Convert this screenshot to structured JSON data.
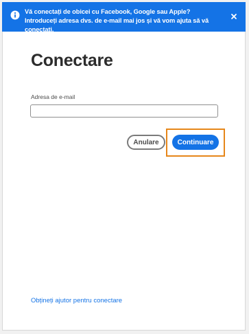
{
  "banner": {
    "message": "Vă conectați de obicei cu Facebook, Google sau Apple? Introduceți adresa dvs. de e-mail mai jos și vă vom ajuta să vă conectați.",
    "info_icon": "info-icon",
    "close_icon": "close-icon"
  },
  "page": {
    "title": "Conectare"
  },
  "form": {
    "email_label": "Adresa de e-mail",
    "email_value": "",
    "email_placeholder": ""
  },
  "actions": {
    "cancel_label": "Anulare",
    "continue_label": "Continuare"
  },
  "footer": {
    "help_link": "Obțineți ajutor pentru conectare"
  },
  "colors": {
    "accent": "#1473e6",
    "focus": "#e68619",
    "title_text": "#2c2c2c"
  }
}
